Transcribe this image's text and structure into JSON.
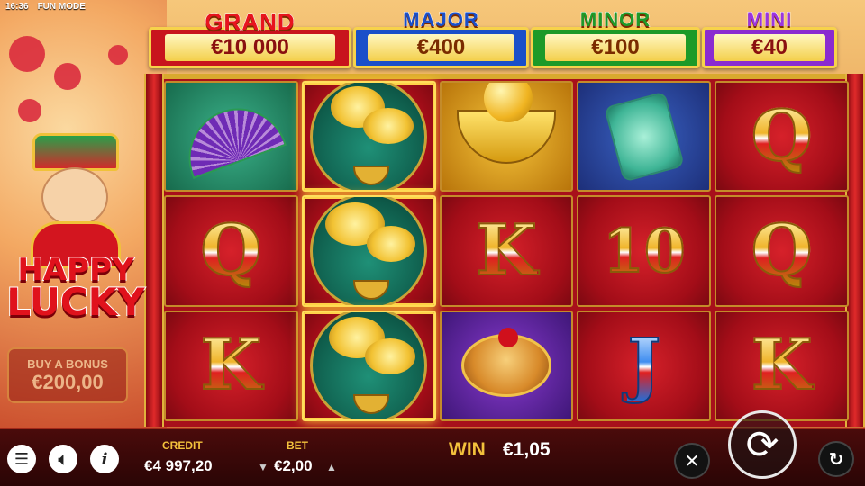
{
  "status": {
    "time": "16:36",
    "mode": "FUN MODE"
  },
  "jackpots": {
    "grand": {
      "title": "GRAND",
      "value": "€10 000"
    },
    "major": {
      "title": "MAJOR",
      "value": "€400"
    },
    "minor": {
      "title": "MINOR",
      "value": "€100"
    },
    "mini": {
      "title": "MINI",
      "value": "€40"
    }
  },
  "logo": {
    "line1": "HAPPY",
    "line2": "LUCKY"
  },
  "bonus": {
    "label": "BUY A BONUS",
    "price": "€200,00"
  },
  "reels": [
    [
      "fan-symbol",
      "Q",
      "K"
    ],
    [
      "coin-tree-symbol",
      "coin-tree-symbol",
      "coin-tree-symbol"
    ],
    [
      "gold-ingot-symbol",
      "K",
      "drum-symbol"
    ],
    [
      "jade-pendant-symbol",
      "10",
      "J"
    ],
    [
      "Q",
      "Q",
      "K"
    ]
  ],
  "winning_reel": 2,
  "meters": {
    "credit_label": "CREDIT",
    "credit_value": "€4 997,20",
    "bet_label": "BET",
    "bet_value": "€2,00",
    "win_label": "WIN",
    "win_value": "€1,05"
  },
  "icons": {
    "menu": "hamburger-icon",
    "sound": "speaker-icon",
    "info": "info-icon",
    "turbo": "turbo-off-icon",
    "spin": "spin-arrows-icon",
    "autoplay": "autoplay-icon"
  },
  "colors": {
    "grand": "#c8141d",
    "major": "#1a4fc9",
    "minor": "#1c9a28",
    "mini": "#8a2bd0",
    "label_gold": "#f3c13c"
  }
}
